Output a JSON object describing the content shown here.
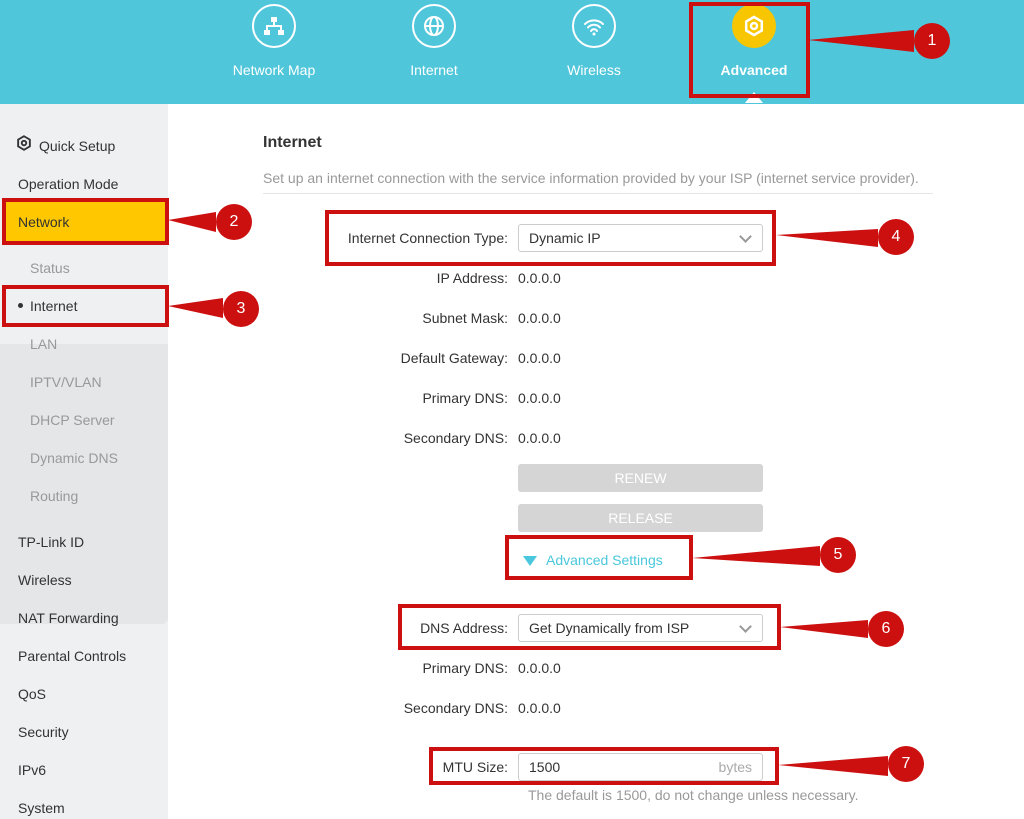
{
  "topnav": {
    "items": [
      {
        "label": "Network Map",
        "icon": "network-map-icon"
      },
      {
        "label": "Internet",
        "icon": "globe-icon"
      },
      {
        "label": "Wireless",
        "icon": "wifi-icon"
      },
      {
        "label": "Advanced",
        "icon": "gear-icon",
        "active": true
      }
    ]
  },
  "sidebar": {
    "quick_setup": "Quick Setup",
    "operation_mode": "Operation Mode",
    "network": "Network",
    "sub": [
      "Status",
      "Internet",
      "LAN",
      "IPTV/VLAN",
      "DHCP Server",
      "Dynamic DNS",
      "Routing"
    ],
    "items": [
      "TP-Link ID",
      "Wireless",
      "NAT Forwarding",
      "Parental Controls",
      "QoS",
      "Security",
      "IPv6",
      "System"
    ]
  },
  "main": {
    "title": "Internet",
    "description": "Set up an internet connection with the service information provided by your ISP (internet service provider).",
    "connection_type_label": "Internet Connection Type:",
    "connection_type_value": "Dynamic IP",
    "fields": [
      {
        "label": "IP Address:",
        "value": "0.0.0.0"
      },
      {
        "label": "Subnet Mask:",
        "value": "0.0.0.0"
      },
      {
        "label": "Default Gateway:",
        "value": "0.0.0.0"
      },
      {
        "label": "Primary DNS:",
        "value": "0.0.0.0"
      },
      {
        "label": "Secondary DNS:",
        "value": "0.0.0.0"
      }
    ],
    "renew": "RENEW",
    "release": "RELEASE",
    "advanced_settings": "Advanced Settings",
    "dns_address_label": "DNS Address:",
    "dns_address_value": "Get Dynamically from ISP",
    "dns_fields": [
      {
        "label": "Primary DNS:",
        "value": "0.0.0.0"
      },
      {
        "label": "Secondary DNS:",
        "value": "0.0.0.0"
      }
    ],
    "mtu_label": "MTU Size:",
    "mtu_value": "1500",
    "mtu_unit": "bytes",
    "mtu_hint": "The default is 1500, do not change unless necessary."
  },
  "annotations": [
    "1",
    "2",
    "3",
    "4",
    "5",
    "6",
    "7"
  ],
  "colors": {
    "accent": "#4ac7dc",
    "highlight": "#ffc700",
    "annotation": "#cc1010"
  }
}
